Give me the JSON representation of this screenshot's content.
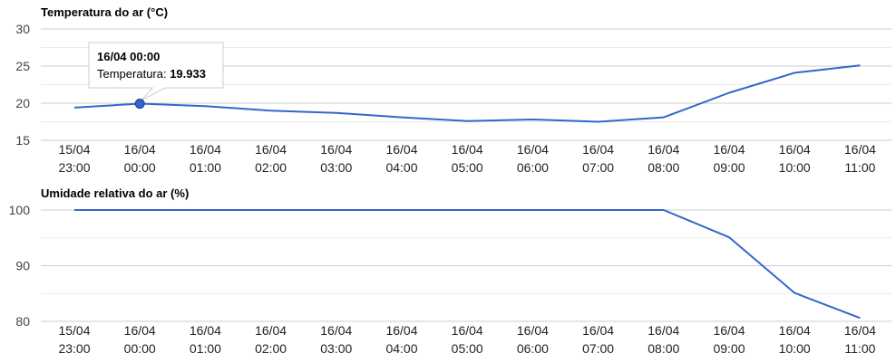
{
  "colors": {
    "series": "#3366cc",
    "grid": "#cccccc",
    "grid_minor": "#ebebeb"
  },
  "chart_data": [
    {
      "type": "line",
      "title": "Temperatura do ar (°C)",
      "xlabel": "",
      "ylabel": "",
      "categories": [
        "15/04 23:00",
        "16/04 00:00",
        "16/04 01:00",
        "16/04 02:00",
        "16/04 03:00",
        "16/04 04:00",
        "16/04 05:00",
        "16/04 06:00",
        "16/04 07:00",
        "16/04 08:00",
        "16/04 09:00",
        "16/04 10:00",
        "16/04 11:00"
      ],
      "category_lines": [
        [
          "15/04",
          "23:00"
        ],
        [
          "16/04",
          "00:00"
        ],
        [
          "16/04",
          "01:00"
        ],
        [
          "16/04",
          "02:00"
        ],
        [
          "16/04",
          "03:00"
        ],
        [
          "16/04",
          "04:00"
        ],
        [
          "16/04",
          "05:00"
        ],
        [
          "16/04",
          "06:00"
        ],
        [
          "16/04",
          "07:00"
        ],
        [
          "16/04",
          "08:00"
        ],
        [
          "16/04",
          "09:00"
        ],
        [
          "16/04",
          "10:00"
        ],
        [
          "16/04",
          "11:00"
        ]
      ],
      "series": [
        {
          "values": [
            19.4,
            19.933,
            19.6,
            19.0,
            18.7,
            18.1,
            17.6,
            17.8,
            17.5,
            18.1,
            21.4,
            24.1,
            25.1
          ]
        }
      ],
      "ylim": [
        15,
        30
      ],
      "yticks": [
        15,
        20,
        25,
        30
      ],
      "grid": true,
      "legend": "none",
      "tooltip": {
        "index": 1,
        "title": "16/04 00:00",
        "label": "Temperatura:",
        "value": "19.933"
      }
    },
    {
      "type": "line",
      "title": "Umidade relativa do ar (%)",
      "xlabel": "",
      "ylabel": "",
      "categories": [
        "15/04 23:00",
        "16/04 00:00",
        "16/04 01:00",
        "16/04 02:00",
        "16/04 03:00",
        "16/04 04:00",
        "16/04 05:00",
        "16/04 06:00",
        "16/04 07:00",
        "16/04 08:00",
        "16/04 09:00",
        "16/04 10:00",
        "16/04 11:00"
      ],
      "category_lines": [
        [
          "15/04",
          "23:00"
        ],
        [
          "16/04",
          "00:00"
        ],
        [
          "16/04",
          "01:00"
        ],
        [
          "16/04",
          "02:00"
        ],
        [
          "16/04",
          "03:00"
        ],
        [
          "16/04",
          "04:00"
        ],
        [
          "16/04",
          "05:00"
        ],
        [
          "16/04",
          "06:00"
        ],
        [
          "16/04",
          "07:00"
        ],
        [
          "16/04",
          "08:00"
        ],
        [
          "16/04",
          "09:00"
        ],
        [
          "16/04",
          "10:00"
        ],
        [
          "16/04",
          "11:00"
        ]
      ],
      "series": [
        {
          "values": [
            100,
            100,
            100,
            100,
            100,
            100,
            100,
            100,
            100,
            100,
            95.1,
            85.1,
            80.6
          ]
        }
      ],
      "ylim": [
        80,
        100
      ],
      "yticks": [
        80,
        90,
        100
      ],
      "grid": true,
      "legend": "none"
    }
  ]
}
